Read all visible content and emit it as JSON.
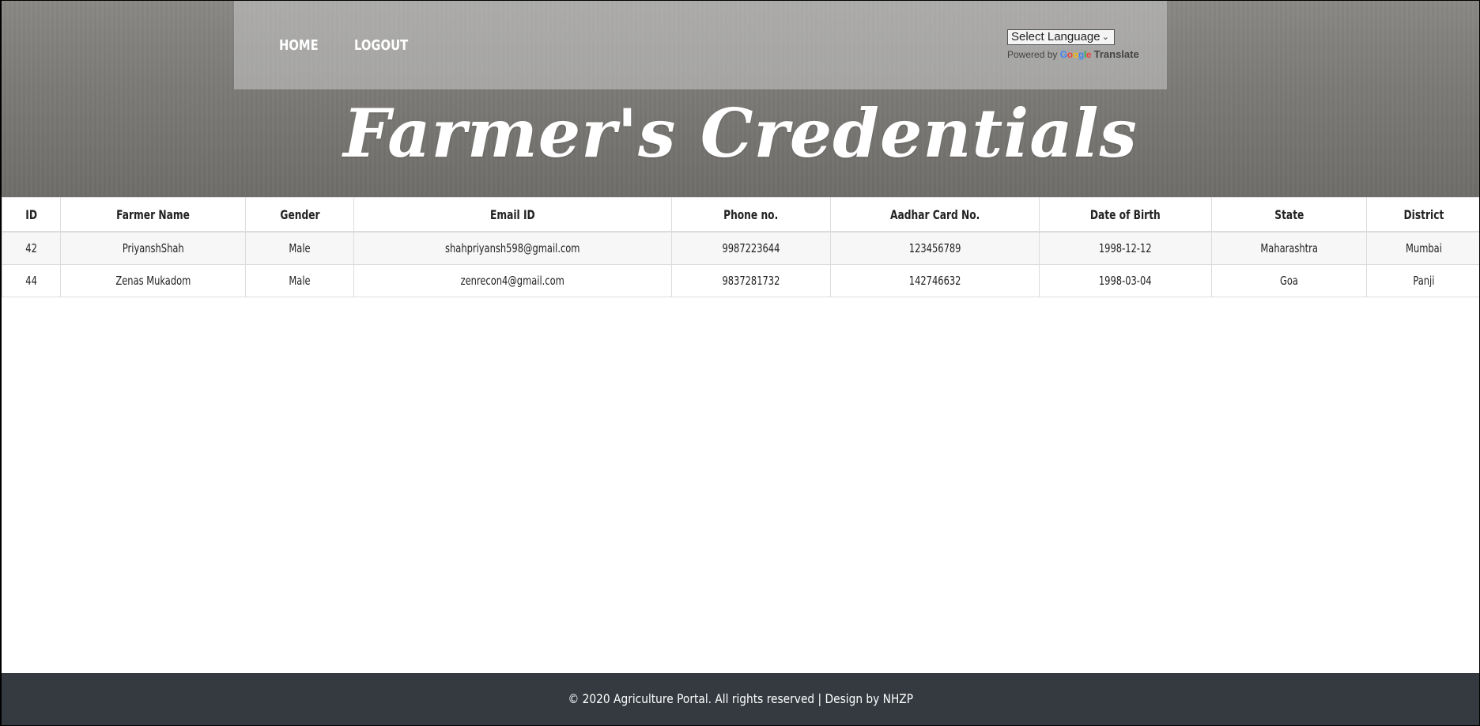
{
  "nav": {
    "home_label": "HOME",
    "logout_label": "LOGOUT"
  },
  "translate": {
    "select_label": "Select Language",
    "powered_by": "Powered by",
    "google_logo": "Google",
    "translate_label": "Translate"
  },
  "page": {
    "title": "Farmer's Credentials"
  },
  "table": {
    "headers": [
      "ID",
      "Farmer Name",
      "Gender",
      "Email ID",
      "Phone no.",
      "Aadhar Card No.",
      "Date of Birth",
      "State",
      "District"
    ],
    "rows": [
      [
        "42",
        "PriyanshShah",
        "Male",
        "shahpriyansh598@gmail.com",
        "9987223644",
        "123456789",
        "1998-12-12",
        "Maharashtra",
        "Mumbai"
      ],
      [
        "44",
        "Zenas Mukadom",
        "Male",
        "zenrecon4@gmail.com",
        "9837281732",
        "142746632",
        "1998-03-04",
        "Goa",
        "Panji"
      ]
    ]
  },
  "footer": {
    "text": "© 2020 Agriculture Portal. All rights reserved | Design by",
    "link_label": "NHZP"
  },
  "colors": {
    "footer_bg": "#343a40",
    "navbar_bg": "rgba(200,200,200,0.55)"
  }
}
